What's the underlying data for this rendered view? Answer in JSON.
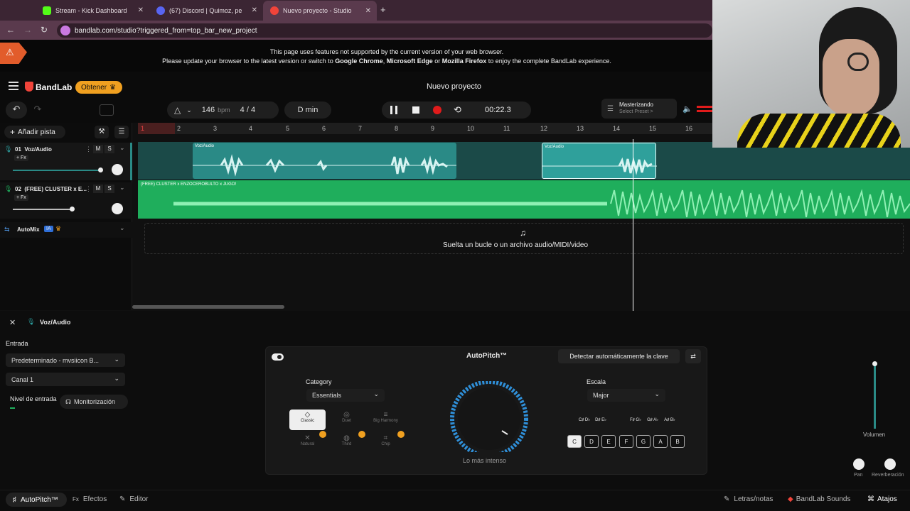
{
  "browser": {
    "tabs": [
      {
        "label": "Stream - Kick Dashboard"
      },
      {
        "label": "(67) Discord | Quimoz, pe"
      },
      {
        "label": "Nuevo proyecto - Studio"
      }
    ],
    "address": "bandlab.com/studio?triggered_from=top_bar_new_project",
    "banner_line1": "This page uses features not supported by the current version of your web browser.",
    "banner_line2_prefix": "Please update your browser to the latest version or switch to ",
    "banner_chrome": "Google Chrome",
    "banner_sep": ", ",
    "banner_edge": "Microsoft Edge",
    "banner_or": " or ",
    "banner_firefox": "Mozilla Firefox",
    "banner_suffix": " to enjoy the complete BandLab experience."
  },
  "app": {
    "logo": "BandLab",
    "get_button": "Obtener",
    "project_title": "Nuevo proyecto",
    "tempo": "146",
    "tempo_unit": "bpm",
    "time_sig_top": "4",
    "time_sig_sep": "/",
    "time_sig_bottom": "4",
    "key": "D min",
    "time": "00:22.3",
    "mastering_title": "Masterizando",
    "mastering_sub": "Select Preset >"
  },
  "tracklist": {
    "add_track": "Añadir pista",
    "tracks": [
      {
        "num": "01",
        "name": "Voz/Audio",
        "fx": "+ Fx",
        "m": "M",
        "s": "S"
      },
      {
        "num": "02",
        "name": "(FREE) CLUSTER x E...",
        "fx": "+ Fx",
        "m": "M",
        "s": "S"
      }
    ],
    "automix": "AutoMix",
    "automix_badge": "IA"
  },
  "ruler": [
    "1",
    "2",
    "3",
    "4",
    "5",
    "6",
    "7",
    "8",
    "9",
    "10",
    "11",
    "12",
    "13",
    "14",
    "15",
    "16"
  ],
  "clips": {
    "vocal1": "Voz/Audio",
    "vocal2": "Voz/Audio",
    "beat": "(FREE) CLUSTER x ENZOCEROBULTO x JUGO!"
  },
  "drop_text": "Suelta un bucle o un archivo audio/MIDI/video",
  "editor": {
    "track_name": "Voz/Audio",
    "input_label": "Entrada",
    "input_device": "Predeterminado - mvsiicon B...",
    "channel": "Canal 1",
    "level_label": "Nivel de entrada",
    "monitor": "Monitorización",
    "plugin_title": "AutoPitch™",
    "detect_key": "Detectar automáticamente la clave",
    "category_label": "Category",
    "category_value": "Essentials",
    "presets": [
      "Classic",
      "Duet",
      "Big Harmony",
      "Natural",
      "Third",
      "Chip"
    ],
    "knob_label": "Lo más intenso",
    "scale_label": "Escala",
    "scale_value": "Major",
    "sharps": [
      "C♯ D♭",
      "D♯ E♭",
      "F♯ G♭",
      "G♯ A♭",
      "A♯ B♭"
    ],
    "keys": [
      "C",
      "D",
      "E",
      "F",
      "G",
      "A",
      "B"
    ],
    "volume_label": "Volumen",
    "pan_label": "Pan",
    "reverb_label": "Reverberación"
  },
  "footer": {
    "autopitch": "AutoPitch™",
    "fx_prefix": "Fx",
    "effects": "Efectos",
    "editor": "Editor",
    "lyrics": "Letras/notas",
    "sounds": "BandLab Sounds",
    "shortcuts": "Atajos"
  },
  "colors": {
    "accent": "#2a8a86",
    "clip_green": "#1fae5c",
    "record": "#e01b1b",
    "brand_red": "#f0443a",
    "knob_blue": "#2f8fd8"
  }
}
